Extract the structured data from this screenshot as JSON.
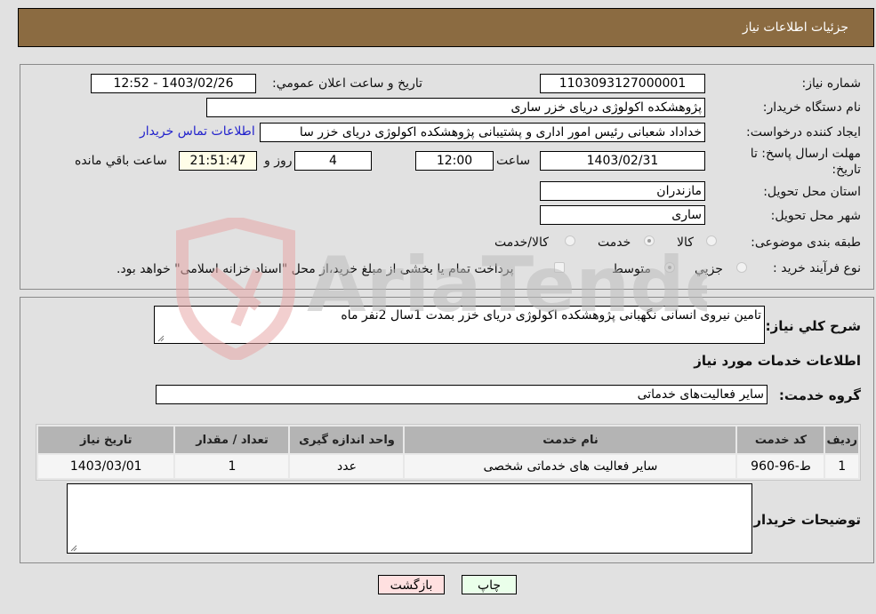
{
  "header": {
    "title": "جزئیات اطلاعات نیاز"
  },
  "details": {
    "need_number_label": "شماره نیاز:",
    "need_number": "1103093127000001",
    "announce_label": "تاریخ و ساعت اعلان عمومي:",
    "announce_value": "1403/02/26 - 12:52",
    "buyer_org_label": "نام دستگاه خريدار:",
    "buyer_org": "پژوهشکده اکولوژی دریای خزر   ساری",
    "creator_label": "ايجاد کننده درخواست:",
    "creator": "خداداد  شعبانی رئیس امور اداری و پشتیبانی پژوهشکده اکولوژی دریای خزر   سا",
    "contact_link": "اطلاعات تماس خريدار",
    "deadline_label": "مهلت ارسال پاسخ: تا تاریخ:",
    "deadline_date": "1403/02/31",
    "time_label": "ساعت",
    "deadline_time": "12:00",
    "days_value": "4",
    "days_label": "روز و",
    "remaining_time": "21:51:47",
    "remaining_label": "ساعت باقي مانده",
    "province_label": "استان محل تحويل:",
    "province": "مازندران",
    "city_label": "شهر محل تحويل:",
    "city": "ساری",
    "category_label": "طبقه بندی موضوعی:",
    "category_options": [
      {
        "label": "کالا",
        "selected": false
      },
      {
        "label": "خدمت",
        "selected": true
      },
      {
        "label": "کالا/خدمت",
        "selected": false
      }
    ],
    "process_label": "نوع فرآيند خريد :",
    "process_options": [
      {
        "label": "جزيي",
        "selected": false
      },
      {
        "label": "متوسط",
        "selected": true
      }
    ],
    "treasury_checkbox": {
      "checked": false,
      "label": "پرداخت تمام يا بخشی از مبلغ خريد،از محل \"اسناد خزانه اسلامی\" خواهد بود."
    }
  },
  "description": {
    "label": "شرح کلي نياز:",
    "value": "تامین نیروی انسانی نگهبانی پژوهشکده اکولوژی دریای خزر بمدت 1سال 2نفر ماه"
  },
  "services": {
    "section_title": "اطلاعات خدمات مورد نياز",
    "group_label": "گروه خدمت:",
    "group_value": "ساير فعاليت‌هاى خدماتى",
    "columns": [
      "رديف",
      "کد خدمت",
      "نام خدمت",
      "واحد اندازه گيری",
      "تعداد / مقدار",
      "تاريخ نياز"
    ],
    "rows": [
      [
        "1",
        "ط-96-960",
        "سایر فعالیت های خدماتی شخصی",
        "عدد",
        "1",
        "1403/03/01"
      ]
    ]
  },
  "buyer_notes": {
    "label": "توضيحات خريدار:",
    "value": ""
  },
  "buttons": {
    "print": "چاپ",
    "back": "بازگشت"
  },
  "watermark": {
    "text": "AriaTender.neT"
  },
  "colors": {
    "header_bg": "#8b6b41",
    "link": "#2222cc",
    "back_btn": "#ffe0e0",
    "print_btn": "#eaffea"
  }
}
